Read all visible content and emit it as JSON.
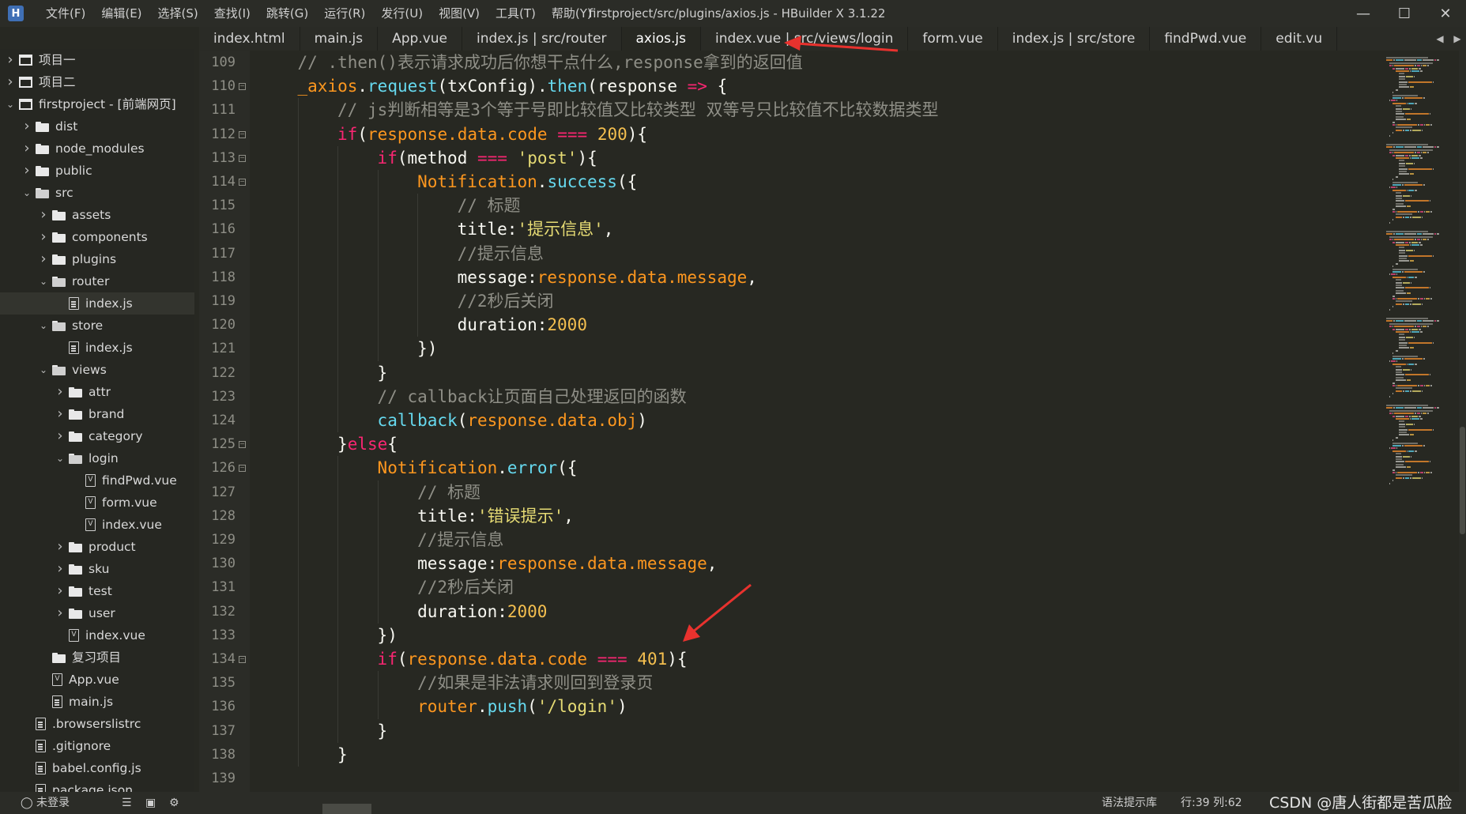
{
  "app": {
    "logo": "H",
    "window_title": "firstproject/src/plugins/axios.js - HBuilder X 3.1.22"
  },
  "menu": [
    "文件(F)",
    "编辑(E)",
    "选择(S)",
    "查找(I)",
    "跳转(G)",
    "运行(R)",
    "发行(U)",
    "视图(V)",
    "工具(T)",
    "帮助(Y)"
  ],
  "tabs": [
    {
      "label": "index.html",
      "active": false
    },
    {
      "label": "main.js",
      "active": false
    },
    {
      "label": "App.vue",
      "active": false
    },
    {
      "label": "index.js | src/router",
      "active": false
    },
    {
      "label": "axios.js",
      "active": true
    },
    {
      "label": "index.vue | src/views/login",
      "active": false
    },
    {
      "label": "form.vue",
      "active": false
    },
    {
      "label": "index.js | src/store",
      "active": false
    },
    {
      "label": "findPwd.vue",
      "active": false
    },
    {
      "label": "edit.vu",
      "active": false
    }
  ],
  "sidebar": {
    "items": [
      {
        "label": "项目一",
        "level": 0,
        "type": "project",
        "state": "collapsed"
      },
      {
        "label": "项目二",
        "level": 0,
        "type": "project",
        "state": "collapsed"
      },
      {
        "label": "firstproject - [前端网页]",
        "level": 0,
        "type": "project",
        "state": "expanded"
      },
      {
        "label": "dist",
        "level": 1,
        "type": "folder",
        "state": "collapsed"
      },
      {
        "label": "node_modules",
        "level": 1,
        "type": "folder",
        "state": "collapsed"
      },
      {
        "label": "public",
        "level": 1,
        "type": "folder",
        "state": "collapsed"
      },
      {
        "label": "src",
        "level": 1,
        "type": "folder",
        "state": "expanded"
      },
      {
        "label": "assets",
        "level": 2,
        "type": "folder",
        "state": "collapsed"
      },
      {
        "label": "components",
        "level": 2,
        "type": "folder",
        "state": "collapsed"
      },
      {
        "label": "plugins",
        "level": 2,
        "type": "folder",
        "state": "collapsed"
      },
      {
        "label": "router",
        "level": 2,
        "type": "folder",
        "state": "expanded"
      },
      {
        "label": "index.js",
        "level": 3,
        "type": "file",
        "state": "none",
        "selected": true
      },
      {
        "label": "store",
        "level": 2,
        "type": "folder",
        "state": "expanded"
      },
      {
        "label": "index.js",
        "level": 3,
        "type": "file",
        "state": "none"
      },
      {
        "label": "views",
        "level": 2,
        "type": "folder",
        "state": "expanded"
      },
      {
        "label": "attr",
        "level": 3,
        "type": "folder",
        "state": "collapsed"
      },
      {
        "label": "brand",
        "level": 3,
        "type": "folder",
        "state": "collapsed"
      },
      {
        "label": "category",
        "level": 3,
        "type": "folder",
        "state": "collapsed"
      },
      {
        "label": "login",
        "level": 3,
        "type": "folder",
        "state": "expanded"
      },
      {
        "label": "findPwd.vue",
        "level": 4,
        "type": "vue",
        "state": "none"
      },
      {
        "label": "form.vue",
        "level": 4,
        "type": "vue",
        "state": "none"
      },
      {
        "label": "index.vue",
        "level": 4,
        "type": "vue",
        "state": "none"
      },
      {
        "label": "product",
        "level": 3,
        "type": "folder",
        "state": "collapsed"
      },
      {
        "label": "sku",
        "level": 3,
        "type": "folder",
        "state": "collapsed"
      },
      {
        "label": "test",
        "level": 3,
        "type": "folder",
        "state": "collapsed"
      },
      {
        "label": "user",
        "level": 3,
        "type": "folder",
        "state": "collapsed"
      },
      {
        "label": "index.vue",
        "level": 3,
        "type": "vue",
        "state": "none"
      },
      {
        "label": "复习项目",
        "level": 2,
        "type": "folder",
        "state": "none"
      },
      {
        "label": "App.vue",
        "level": 2,
        "type": "vue",
        "state": "none"
      },
      {
        "label": "main.js",
        "level": 2,
        "type": "file",
        "state": "none"
      },
      {
        "label": ".browserslistrc",
        "level": 1,
        "type": "file",
        "state": "none"
      },
      {
        "label": ".gitignore",
        "level": 1,
        "type": "file",
        "state": "none"
      },
      {
        "label": "babel.config.js",
        "level": 1,
        "type": "file",
        "state": "none"
      },
      {
        "label": "package.json",
        "level": 1,
        "type": "file",
        "state": "none"
      }
    ]
  },
  "editor": {
    "lines": [
      {
        "n": "109",
        "fold": false,
        "indent": 2,
        "t": [
          [
            "cm",
            "// .then()表示请求成功后你想干点什么,response拿到的返回值"
          ]
        ]
      },
      {
        "n": "110",
        "fold": true,
        "indent": 2,
        "t": [
          [
            "prop",
            "_axios"
          ],
          [
            "pl",
            "."
          ],
          [
            "fn",
            "request"
          ],
          [
            "pl",
            "(txConfig)."
          ],
          [
            "fn",
            "then"
          ],
          [
            "pl",
            "(response "
          ],
          [
            "op",
            "=>"
          ],
          [
            "pl",
            " {"
          ]
        ]
      },
      {
        "n": "111",
        "fold": false,
        "indent": 3,
        "t": [
          [
            "cm",
            "// js判断相等是3个等于号即比较值又比较类型 双等号只比较值不比较数据类型"
          ]
        ]
      },
      {
        "n": "112",
        "fold": true,
        "indent": 3,
        "t": [
          [
            "kw",
            "if"
          ],
          [
            "pl",
            "("
          ],
          [
            "prop",
            "response.data.code"
          ],
          [
            "pl",
            " "
          ],
          [
            "op",
            "==="
          ],
          [
            "pl",
            " "
          ],
          [
            "num2",
            "200"
          ],
          [
            "pl",
            "){"
          ]
        ]
      },
      {
        "n": "113",
        "fold": true,
        "indent": 4,
        "t": [
          [
            "kw",
            "if"
          ],
          [
            "pl",
            "(method "
          ],
          [
            "op",
            "==="
          ],
          [
            "pl",
            " "
          ],
          [
            "str",
            "'post'"
          ],
          [
            "pl",
            "){"
          ]
        ]
      },
      {
        "n": "114",
        "fold": true,
        "indent": 5,
        "t": [
          [
            "prop",
            "Notification"
          ],
          [
            "pl",
            "."
          ],
          [
            "fn",
            "success"
          ],
          [
            "pl",
            "({"
          ]
        ]
      },
      {
        "n": "115",
        "fold": false,
        "indent": 6,
        "t": [
          [
            "cm",
            "// 标题"
          ]
        ]
      },
      {
        "n": "116",
        "fold": false,
        "indent": 6,
        "t": [
          [
            "pl",
            "title:"
          ],
          [
            "str",
            "'提示信息'"
          ],
          [
            "pl",
            ","
          ]
        ]
      },
      {
        "n": "117",
        "fold": false,
        "indent": 6,
        "t": [
          [
            "cm",
            "//提示信息"
          ]
        ]
      },
      {
        "n": "118",
        "fold": false,
        "indent": 6,
        "t": [
          [
            "pl",
            "message:"
          ],
          [
            "prop",
            "response.data.message"
          ],
          [
            "pl",
            ","
          ]
        ]
      },
      {
        "n": "119",
        "fold": false,
        "indent": 6,
        "t": [
          [
            "cm",
            "//2秒后关闭"
          ]
        ]
      },
      {
        "n": "120",
        "fold": false,
        "indent": 6,
        "t": [
          [
            "pl",
            "duration:"
          ],
          [
            "num2",
            "2000"
          ]
        ]
      },
      {
        "n": "121",
        "fold": false,
        "indent": 5,
        "t": [
          [
            "pl",
            "})"
          ]
        ]
      },
      {
        "n": "122",
        "fold": false,
        "indent": 4,
        "t": [
          [
            "pl",
            "}"
          ]
        ]
      },
      {
        "n": "123",
        "fold": false,
        "indent": 4,
        "t": [
          [
            "cm",
            "// callback让页面自己处理返回的函数"
          ]
        ]
      },
      {
        "n": "124",
        "fold": false,
        "indent": 4,
        "t": [
          [
            "fn",
            "callback"
          ],
          [
            "pl",
            "("
          ],
          [
            "prop",
            "response.data.obj"
          ],
          [
            "pl",
            ")"
          ]
        ]
      },
      {
        "n": "125",
        "fold": true,
        "indent": 3,
        "t": [
          [
            "pl",
            "}"
          ],
          [
            "kw",
            "else"
          ],
          [
            "pl",
            "{"
          ]
        ]
      },
      {
        "n": "126",
        "fold": true,
        "indent": 4,
        "t": [
          [
            "prop",
            "Notification"
          ],
          [
            "pl",
            "."
          ],
          [
            "fn",
            "error"
          ],
          [
            "pl",
            "({"
          ]
        ]
      },
      {
        "n": "127",
        "fold": false,
        "indent": 5,
        "t": [
          [
            "cm",
            "// 标题"
          ]
        ]
      },
      {
        "n": "128",
        "fold": false,
        "indent": 5,
        "t": [
          [
            "pl",
            "title:"
          ],
          [
            "str",
            "'错误提示'"
          ],
          [
            "pl",
            ","
          ]
        ]
      },
      {
        "n": "129",
        "fold": false,
        "indent": 5,
        "t": [
          [
            "cm",
            "//提示信息"
          ]
        ]
      },
      {
        "n": "130",
        "fold": false,
        "indent": 5,
        "t": [
          [
            "pl",
            "message:"
          ],
          [
            "prop",
            "response.data.message"
          ],
          [
            "pl",
            ","
          ]
        ]
      },
      {
        "n": "131",
        "fold": false,
        "indent": 5,
        "t": [
          [
            "cm",
            "//2秒后关闭"
          ]
        ]
      },
      {
        "n": "132",
        "fold": false,
        "indent": 5,
        "t": [
          [
            "pl",
            "duration:"
          ],
          [
            "num2",
            "2000"
          ]
        ]
      },
      {
        "n": "133",
        "fold": false,
        "indent": 4,
        "t": [
          [
            "pl",
            "})"
          ]
        ]
      },
      {
        "n": "134",
        "fold": true,
        "indent": 4,
        "t": [
          [
            "kw",
            "if"
          ],
          [
            "pl",
            "("
          ],
          [
            "prop",
            "response.data.code"
          ],
          [
            "pl",
            " "
          ],
          [
            "op",
            "==="
          ],
          [
            "pl",
            " "
          ],
          [
            "num2",
            "401"
          ],
          [
            "pl",
            "){"
          ]
        ]
      },
      {
        "n": "135",
        "fold": false,
        "indent": 5,
        "t": [
          [
            "cm",
            "//如果是非法请求则回到登录页"
          ]
        ]
      },
      {
        "n": "136",
        "fold": false,
        "indent": 5,
        "t": [
          [
            "prop",
            "router"
          ],
          [
            "pl",
            "."
          ],
          [
            "fn",
            "push"
          ],
          [
            "pl",
            "("
          ],
          [
            "str",
            "'/login'"
          ],
          [
            "pl",
            ")"
          ]
        ]
      },
      {
        "n": "137",
        "fold": false,
        "indent": 4,
        "t": [
          [
            "pl",
            "}"
          ]
        ]
      },
      {
        "n": "138",
        "fold": false,
        "indent": 3,
        "t": [
          [
            "pl",
            "}"
          ]
        ]
      },
      {
        "n": "139",
        "fold": false,
        "indent": 0,
        "t": []
      }
    ]
  },
  "statusbar": {
    "login": "未登录",
    "hint": "语法提示库",
    "position": "行:39  列:62",
    "watermark": "CSDN @唐人街都是苦瓜脸"
  },
  "colors": {
    "background": "#272822",
    "comment": "#8f8f87",
    "keyword": "#f92672",
    "function": "#66d9ef",
    "string": "#e6db74",
    "number": "#f4bf4f",
    "property": "#fd971f",
    "annotation_arrow": "#e8322e"
  },
  "icons": {
    "minimize": "minimize-icon",
    "maximize": "maximize-icon",
    "close": "close-icon",
    "folder": "folder-icon",
    "file": "file-icon",
    "chevron": "chevron-icon"
  }
}
